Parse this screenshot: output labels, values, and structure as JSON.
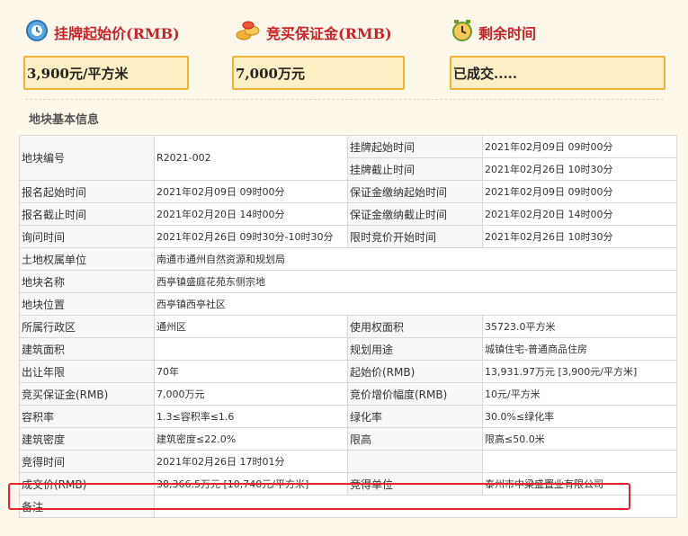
{
  "header": {
    "start_price": {
      "label": "挂牌起始价(RMB)",
      "value": "3,900元/平方米",
      "icon": "price-tag-icon"
    },
    "deposit": {
      "label": "竞买保证金(RMB)",
      "value": "7,000万元",
      "icon": "coins-icon"
    },
    "remaining": {
      "label": "剩余时间",
      "value": "已成交.....",
      "icon": "alarm-clock-icon"
    }
  },
  "section_title": "地块基本信息",
  "rows": {
    "r1": {
      "k1": "地块编号",
      "v1": "R2021-002",
      "k2": "挂牌起始时间",
      "v2": "2021年02月09日 09时00分"
    },
    "r2": {
      "k2": "挂牌截止时间",
      "v2": "2021年02月26日 10时30分"
    },
    "r3": {
      "k1": "报名起始时间",
      "v1": "2021年02月09日 09时00分",
      "k2": "保证金缴纳起始时间",
      "v2": "2021年02月09日 09时00分"
    },
    "r4": {
      "k1": "报名截止时间",
      "v1": "2021年02月20日 14时00分",
      "k2": "保证金缴纳截止时间",
      "v2": "2021年02月20日 14时00分"
    },
    "r5": {
      "k1": "询问时间",
      "v1": "2021年02月26日 09时30分-10时30分",
      "k2": "限时竞价开始时间",
      "v2": "2021年02月26日 10时30分"
    },
    "r6": {
      "k1": "土地权属单位",
      "v1": "南通市通州自然资源和规划局"
    },
    "r7": {
      "k1": "地块名称",
      "v1": "西亭镇盛庭花苑东侧宗地"
    },
    "r8": {
      "k1": "地块位置",
      "v1": "西亭镇西亭社区"
    },
    "r9": {
      "k1": "所属行政区",
      "v1": "通州区",
      "k2": "使用权面积",
      "v2": "35723.0平方米"
    },
    "r10": {
      "k1": "建筑面积",
      "v1": "",
      "k2": "规划用途",
      "v2": "城镇住宅-普通商品住房"
    },
    "r11": {
      "k1": "出让年限",
      "v1": "70年",
      "k2": "起始价(RMB)",
      "v2": "13,931.97万元 [3,900元/平方米]"
    },
    "r12": {
      "k1": "竞买保证金(RMB)",
      "v1": "7,000万元",
      "k2": "竞价增价幅度(RMB)",
      "v2": "10元/平方米"
    },
    "r13": {
      "k1": "容积率",
      "v1": "1.3≤容积率≤1.6",
      "k2": "绿化率",
      "v2": "30.0%≤绿化率"
    },
    "r14": {
      "k1": "建筑密度",
      "v1": "建筑密度≤22.0%",
      "k2": "限高",
      "v2": "限高≤50.0米"
    },
    "r15": {
      "k1": "竞得时间",
      "v1": "2021年02月26日 17时01分",
      "k2": "",
      "v2": ""
    },
    "r16": {
      "k1": "成交价(RMB)",
      "v1": "38,366.5万元 [10,740元/平方米]",
      "k2": "竞得单位",
      "v2": "泰州市中梁盛置业有限公司"
    },
    "r17": {
      "k1": "备注",
      "v1": ""
    }
  },
  "colors": {
    "accent_red": "#c8232a",
    "box_bg": "#fcefc4",
    "box_border": "#f2b23a",
    "highlight": "#e8232a"
  }
}
